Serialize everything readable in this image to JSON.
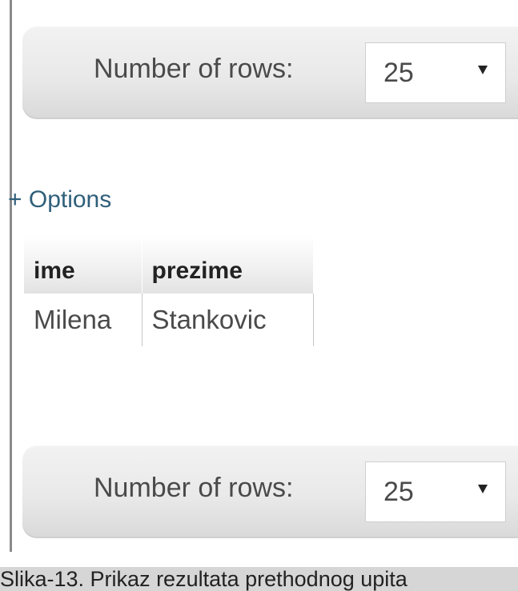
{
  "top_nav": {
    "rows_label": "Number of rows:",
    "rows_value": "25"
  },
  "options_link": "+ Options",
  "table": {
    "columns": [
      "ime",
      "prezime"
    ],
    "rows": [
      [
        "Milena",
        "Stankovic"
      ]
    ]
  },
  "bottom_nav": {
    "rows_label": "Number of rows:",
    "rows_value": "25"
  },
  "caption": "Slika-13. Prikaz rezultata prethodnog upita",
  "colors": {
    "link": "#2f5f7a",
    "text": "#4a4a4a",
    "caption_bg": "#d6d6d6"
  }
}
